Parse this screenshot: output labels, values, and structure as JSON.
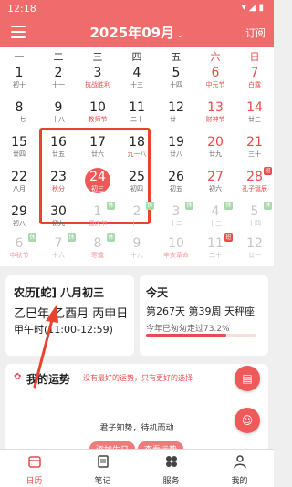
{
  "status": {
    "time": "12:18",
    "icons": [
      "settings-icon",
      "wifi-icon",
      "signal-icon",
      "battery-icon"
    ]
  },
  "appbar": {
    "title": "2025年09月",
    "subscribe": "订阅"
  },
  "weekdays": [
    "一",
    "二",
    "三",
    "四",
    "五",
    "六",
    "日"
  ],
  "calendar": {
    "today_index": 23,
    "highlight_note": "dates 16–2 (two weeks) outlined in red",
    "days": [
      {
        "d": "1",
        "s": "初十"
      },
      {
        "d": "2",
        "s": "十一"
      },
      {
        "d": "3",
        "s": "抗战胜利",
        "t": "red"
      },
      {
        "d": "4",
        "s": "十三"
      },
      {
        "d": "5",
        "s": "十四"
      },
      {
        "d": "6",
        "s": "中元节",
        "t": "red"
      },
      {
        "d": "7",
        "s": "白露",
        "t": "red"
      },
      {
        "d": "8",
        "s": "十七"
      },
      {
        "d": "9",
        "s": "十八"
      },
      {
        "d": "10",
        "s": "教师节",
        "t": "red"
      },
      {
        "d": "11",
        "s": "二十"
      },
      {
        "d": "12",
        "s": "廿一"
      },
      {
        "d": "13",
        "s": "财神节",
        "t": "red"
      },
      {
        "d": "14",
        "s": "廿三"
      },
      {
        "d": "15",
        "s": "廿四"
      },
      {
        "d": "16",
        "s": "廿五"
      },
      {
        "d": "17",
        "s": "廿六"
      },
      {
        "d": "18",
        "s": "九一八",
        "t": "red"
      },
      {
        "d": "19",
        "s": "廿八"
      },
      {
        "d": "20",
        "s": "廿九"
      },
      {
        "d": "21",
        "s": "三十"
      },
      {
        "d": "22",
        "s": "八月"
      },
      {
        "d": "23",
        "s": "秋分",
        "t": "red"
      },
      {
        "d": "24",
        "s": "初三"
      },
      {
        "d": "25",
        "s": "初四"
      },
      {
        "d": "26",
        "s": "初五"
      },
      {
        "d": "27",
        "s": "初六"
      },
      {
        "d": "28",
        "s": "孔子诞辰",
        "t": "red",
        "badge": "班"
      },
      {
        "d": "29",
        "s": "初八"
      },
      {
        "d": "30",
        "s": "初九"
      },
      {
        "d": "1",
        "s": "国庆节",
        "t": "red",
        "dim": true,
        "badge": "休"
      },
      {
        "d": "2",
        "s": "十一",
        "dim": true,
        "badge": "休"
      },
      {
        "d": "3",
        "s": "十二",
        "dim": true,
        "badge": "休"
      },
      {
        "d": "4",
        "s": "十三",
        "dim": true,
        "badge": "休"
      },
      {
        "d": "5",
        "s": "十四",
        "dim": true,
        "badge": "休"
      },
      {
        "d": "6",
        "s": "中秋节",
        "t": "red",
        "dim": true,
        "badge": "休"
      },
      {
        "d": "7",
        "s": "十六",
        "dim": true,
        "badge": "休"
      },
      {
        "d": "8",
        "s": "寒露",
        "t": "red",
        "dim": true,
        "badge": "休"
      },
      {
        "d": "9",
        "s": "十八",
        "dim": true
      },
      {
        "d": "10",
        "s": "辛亥革命",
        "t": "red",
        "dim": true
      },
      {
        "d": "11",
        "s": "二十",
        "dim": true,
        "badge": "班"
      },
      {
        "d": "12",
        "s": "廿一",
        "dim": true
      }
    ]
  },
  "lunar_card": {
    "title": "农历[蛇] 八月初三",
    "line2": "乙巳年 乙酉月 丙申日",
    "line3": "甲午时(11:00-12:59)"
  },
  "today_card": {
    "title": "今天",
    "line2": "第267天 第39周 天秤座",
    "progress_text": "今年已匆匆走过73.2%",
    "progress": 0.732
  },
  "fortune": {
    "title": "我的运势",
    "hint": "没有最好的运势，只有更好的选择",
    "quote": "君子知势，待机而动",
    "buttons": [
      "添加生日",
      "查看运势"
    ]
  },
  "tabs": [
    {
      "label": "日历",
      "icon": "calendar-icon",
      "active": true
    },
    {
      "label": "笔记",
      "icon": "note-icon",
      "active": false
    },
    {
      "label": "服务",
      "icon": "grid-icon",
      "active": false
    },
    {
      "label": "我的",
      "icon": "person-icon",
      "active": false
    }
  ],
  "colors": {
    "accent": "#f06b6b",
    "holiday": "#e84c4c",
    "rest": "#4caf50",
    "highlight_box": "#e8432f"
  }
}
